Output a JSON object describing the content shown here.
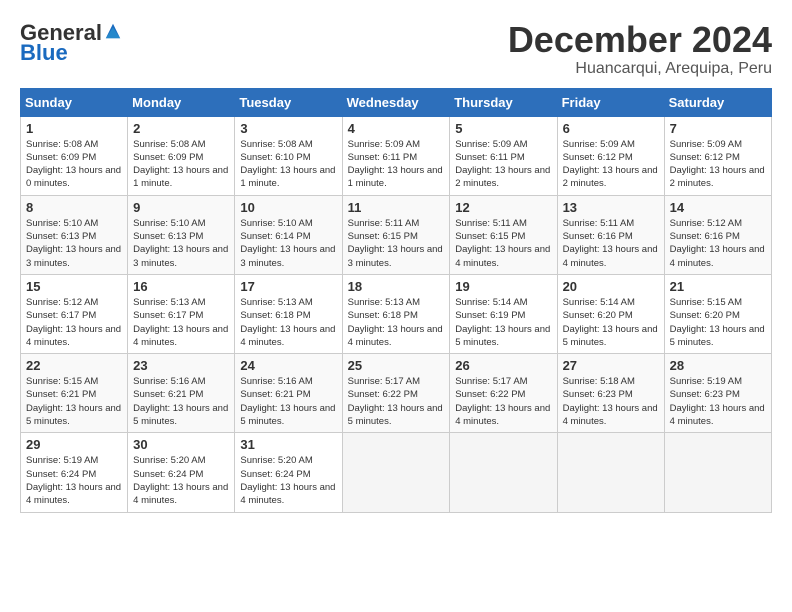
{
  "logo": {
    "general": "General",
    "blue": "Blue"
  },
  "title": {
    "month_year": "December 2024",
    "location": "Huancarqui, Arequipa, Peru"
  },
  "weekdays": [
    "Sunday",
    "Monday",
    "Tuesday",
    "Wednesday",
    "Thursday",
    "Friday",
    "Saturday"
  ],
  "weeks": [
    [
      {
        "day": "1",
        "sunrise": "5:08 AM",
        "sunset": "6:09 PM",
        "daylight": "13 hours and 0 minutes."
      },
      {
        "day": "2",
        "sunrise": "5:08 AM",
        "sunset": "6:09 PM",
        "daylight": "13 hours and 1 minute."
      },
      {
        "day": "3",
        "sunrise": "5:08 AM",
        "sunset": "6:10 PM",
        "daylight": "13 hours and 1 minute."
      },
      {
        "day": "4",
        "sunrise": "5:09 AM",
        "sunset": "6:11 PM",
        "daylight": "13 hours and 1 minute."
      },
      {
        "day": "5",
        "sunrise": "5:09 AM",
        "sunset": "6:11 PM",
        "daylight": "13 hours and 2 minutes."
      },
      {
        "day": "6",
        "sunrise": "5:09 AM",
        "sunset": "6:12 PM",
        "daylight": "13 hours and 2 minutes."
      },
      {
        "day": "7",
        "sunrise": "5:09 AM",
        "sunset": "6:12 PM",
        "daylight": "13 hours and 2 minutes."
      }
    ],
    [
      {
        "day": "8",
        "sunrise": "5:10 AM",
        "sunset": "6:13 PM",
        "daylight": "13 hours and 3 minutes."
      },
      {
        "day": "9",
        "sunrise": "5:10 AM",
        "sunset": "6:13 PM",
        "daylight": "13 hours and 3 minutes."
      },
      {
        "day": "10",
        "sunrise": "5:10 AM",
        "sunset": "6:14 PM",
        "daylight": "13 hours and 3 minutes."
      },
      {
        "day": "11",
        "sunrise": "5:11 AM",
        "sunset": "6:15 PM",
        "daylight": "13 hours and 3 minutes."
      },
      {
        "day": "12",
        "sunrise": "5:11 AM",
        "sunset": "6:15 PM",
        "daylight": "13 hours and 4 minutes."
      },
      {
        "day": "13",
        "sunrise": "5:11 AM",
        "sunset": "6:16 PM",
        "daylight": "13 hours and 4 minutes."
      },
      {
        "day": "14",
        "sunrise": "5:12 AM",
        "sunset": "6:16 PM",
        "daylight": "13 hours and 4 minutes."
      }
    ],
    [
      {
        "day": "15",
        "sunrise": "5:12 AM",
        "sunset": "6:17 PM",
        "daylight": "13 hours and 4 minutes."
      },
      {
        "day": "16",
        "sunrise": "5:13 AM",
        "sunset": "6:17 PM",
        "daylight": "13 hours and 4 minutes."
      },
      {
        "day": "17",
        "sunrise": "5:13 AM",
        "sunset": "6:18 PM",
        "daylight": "13 hours and 4 minutes."
      },
      {
        "day": "18",
        "sunrise": "5:13 AM",
        "sunset": "6:18 PM",
        "daylight": "13 hours and 4 minutes."
      },
      {
        "day": "19",
        "sunrise": "5:14 AM",
        "sunset": "6:19 PM",
        "daylight": "13 hours and 5 minutes."
      },
      {
        "day": "20",
        "sunrise": "5:14 AM",
        "sunset": "6:20 PM",
        "daylight": "13 hours and 5 minutes."
      },
      {
        "day": "21",
        "sunrise": "5:15 AM",
        "sunset": "6:20 PM",
        "daylight": "13 hours and 5 minutes."
      }
    ],
    [
      {
        "day": "22",
        "sunrise": "5:15 AM",
        "sunset": "6:21 PM",
        "daylight": "13 hours and 5 minutes."
      },
      {
        "day": "23",
        "sunrise": "5:16 AM",
        "sunset": "6:21 PM",
        "daylight": "13 hours and 5 minutes."
      },
      {
        "day": "24",
        "sunrise": "5:16 AM",
        "sunset": "6:21 PM",
        "daylight": "13 hours and 5 minutes."
      },
      {
        "day": "25",
        "sunrise": "5:17 AM",
        "sunset": "6:22 PM",
        "daylight": "13 hours and 5 minutes."
      },
      {
        "day": "26",
        "sunrise": "5:17 AM",
        "sunset": "6:22 PM",
        "daylight": "13 hours and 4 minutes."
      },
      {
        "day": "27",
        "sunrise": "5:18 AM",
        "sunset": "6:23 PM",
        "daylight": "13 hours and 4 minutes."
      },
      {
        "day": "28",
        "sunrise": "5:19 AM",
        "sunset": "6:23 PM",
        "daylight": "13 hours and 4 minutes."
      }
    ],
    [
      {
        "day": "29",
        "sunrise": "5:19 AM",
        "sunset": "6:24 PM",
        "daylight": "13 hours and 4 minutes."
      },
      {
        "day": "30",
        "sunrise": "5:20 AM",
        "sunset": "6:24 PM",
        "daylight": "13 hours and 4 minutes."
      },
      {
        "day": "31",
        "sunrise": "5:20 AM",
        "sunset": "6:24 PM",
        "daylight": "13 hours and 4 minutes."
      },
      null,
      null,
      null,
      null
    ]
  ]
}
